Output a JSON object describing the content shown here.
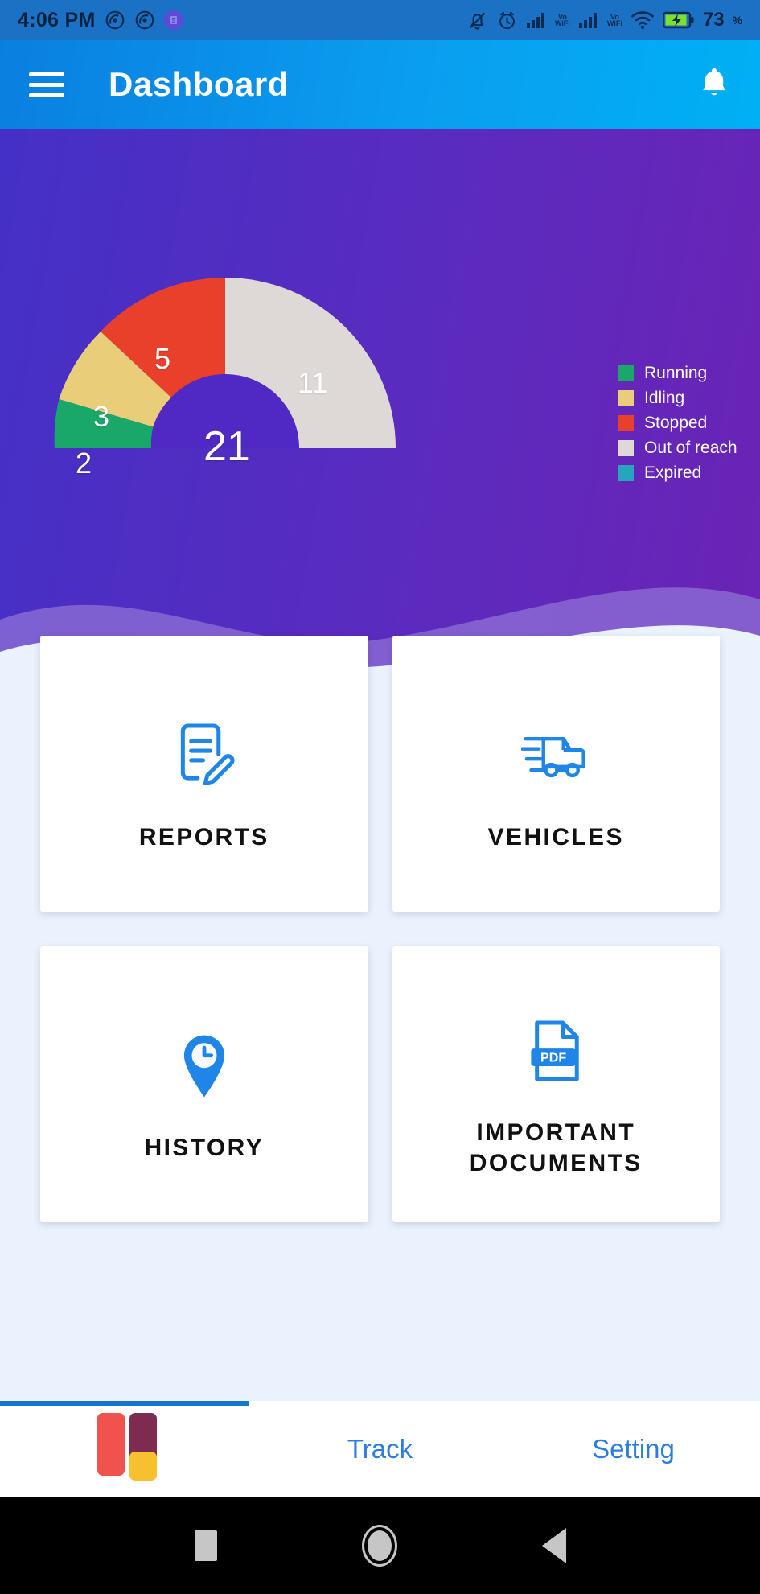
{
  "statusbar": {
    "time": "4:06 PM",
    "battery_percent": "73",
    "percent_symbol": "%",
    "vowifi_label_1": "Vo",
    "vowifi_label_2": "WiFi",
    "icons": [
      "mute-bell-icon",
      "alarm-icon",
      "signal-icon",
      "vowifi-icon",
      "wifi-icon",
      "battery-charging-icon"
    ]
  },
  "appbar": {
    "title": "Dashboard",
    "menu_icon": "hamburger-menu-icon",
    "notification_icon": "bell-icon"
  },
  "chart_data": {
    "type": "pie",
    "title": "",
    "total": 21,
    "categories": [
      "Running",
      "Idling",
      "Stopped",
      "Out of reach",
      "Expired"
    ],
    "values": [
      2,
      3,
      5,
      11,
      0
    ],
    "colors": [
      "#1aa86a",
      "#e9cd79",
      "#e8402a",
      "#ded8d6",
      "#26a6bd"
    ],
    "legend_position": "right",
    "labels_shown": [
      "2",
      "3",
      "5",
      "11"
    ],
    "center_label": "21"
  },
  "gauge": {
    "running": "2",
    "idling": "3",
    "stopped": "5",
    "out_of_reach": "11",
    "total": "21"
  },
  "legend": [
    {
      "label": "Running",
      "color": "#1aa86a"
    },
    {
      "label": "Idling",
      "color": "#e9cd79"
    },
    {
      "label": "Stopped",
      "color": "#e8402a"
    },
    {
      "label": "Out of reach",
      "color": "#ded8d6"
    },
    {
      "label": "Expired",
      "color": "#26a6bd"
    }
  ],
  "cards": [
    {
      "label": "REPORTS",
      "icon": "document-edit-icon"
    },
    {
      "label": "VEHICLES",
      "icon": "truck-icon"
    },
    {
      "label": "HISTORY",
      "icon": "map-pin-clock-icon"
    },
    {
      "label": "IMPORTANT\nDOCUMENTS",
      "icon": "pdf-file-icon",
      "line1": "IMPORTANT",
      "line2": "DOCUMENTS"
    }
  ],
  "bottomnav": {
    "logo_icon": "app-blocks-logo-icon",
    "items": [
      "Track",
      "Setting"
    ],
    "accent_color": "#2b7de0"
  },
  "androidnav": {
    "recents_icon": "square-recents-icon",
    "home_icon": "circle-home-icon",
    "back_icon": "triangle-back-icon"
  },
  "theme": {
    "appbar_blue": "#0a9ef0",
    "hero_purple": "#5b2bbf",
    "page_bg": "#eaf2fd",
    "card_icon_blue": "#1f86e8"
  }
}
